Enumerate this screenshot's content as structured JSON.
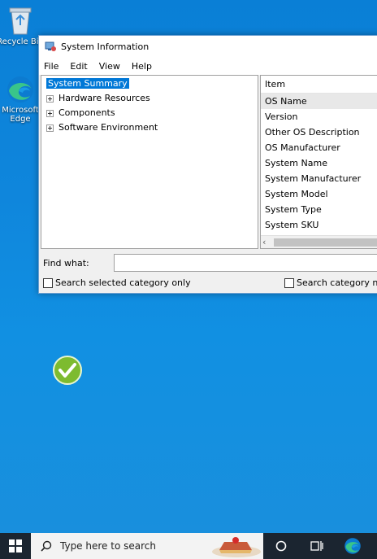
{
  "desktop": {
    "icons": [
      {
        "label": "Recycle Bin",
        "icon": "recycle-bin-icon"
      },
      {
        "label": "Microsoft Edge",
        "icon": "edge-icon"
      }
    ]
  },
  "window": {
    "title": "System Information",
    "menu": [
      "File",
      "Edit",
      "View",
      "Help"
    ],
    "tree": [
      {
        "label": "System Summary",
        "selected": true,
        "expandable": false
      },
      {
        "label": "Hardware Resources",
        "expandable": true
      },
      {
        "label": "Components",
        "expandable": true
      },
      {
        "label": "Software Environment",
        "expandable": true
      }
    ],
    "list": {
      "header": "Item",
      "rows": [
        "OS Name",
        "Version",
        "Other OS Description",
        "OS Manufacturer",
        "System Name",
        "System Manufacturer",
        "System Model",
        "System Type",
        "System SKU"
      ]
    },
    "find_label": "Find what:",
    "check1": "Search selected category only",
    "check2": "Search category na"
  },
  "taskbar": {
    "search_placeholder": "Type here to search"
  },
  "colors": {
    "accent": "#0078d7",
    "taskbar": "#1b2530"
  }
}
